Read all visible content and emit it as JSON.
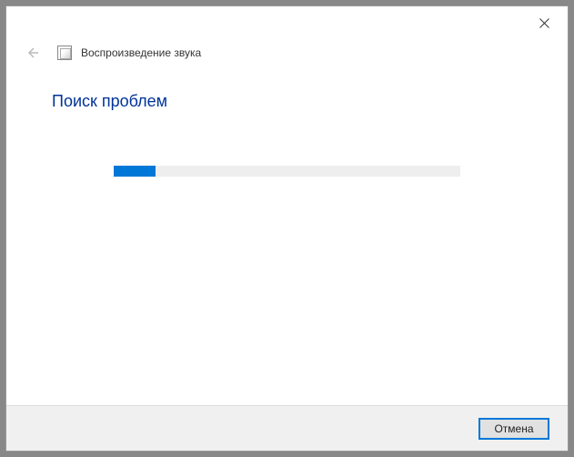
{
  "window": {
    "title": "Воспроизведение звука"
  },
  "content": {
    "heading": "Поиск проблем",
    "progress_percent": 12
  },
  "footer": {
    "cancel_label": "Отмена"
  }
}
